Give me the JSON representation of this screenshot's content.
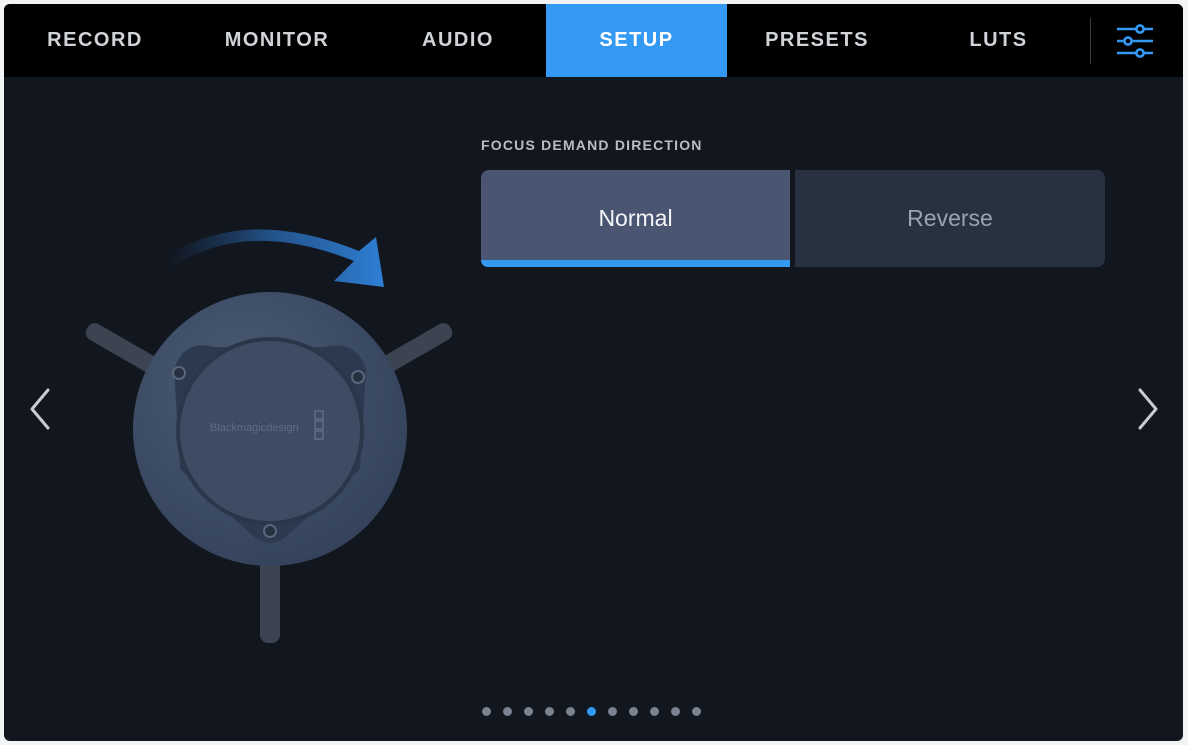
{
  "tabs": [
    {
      "label": "RECORD",
      "active": false
    },
    {
      "label": "MONITOR",
      "active": false
    },
    {
      "label": "AUDIO",
      "active": false
    },
    {
      "label": "SETUP",
      "active": true
    },
    {
      "label": "PRESETS",
      "active": false
    },
    {
      "label": "LUTS",
      "active": false
    }
  ],
  "setting": {
    "title": "FOCUS DEMAND DIRECTION",
    "options": [
      "Normal",
      "Reverse"
    ],
    "selected": "Normal"
  },
  "illustration": {
    "brand_text": "Blackmagicdesign"
  },
  "pager": {
    "total_pages": 11,
    "current_page": 6
  },
  "colors": {
    "accent": "#3399f2",
    "background": "#12161e",
    "topbar": "#000000"
  }
}
